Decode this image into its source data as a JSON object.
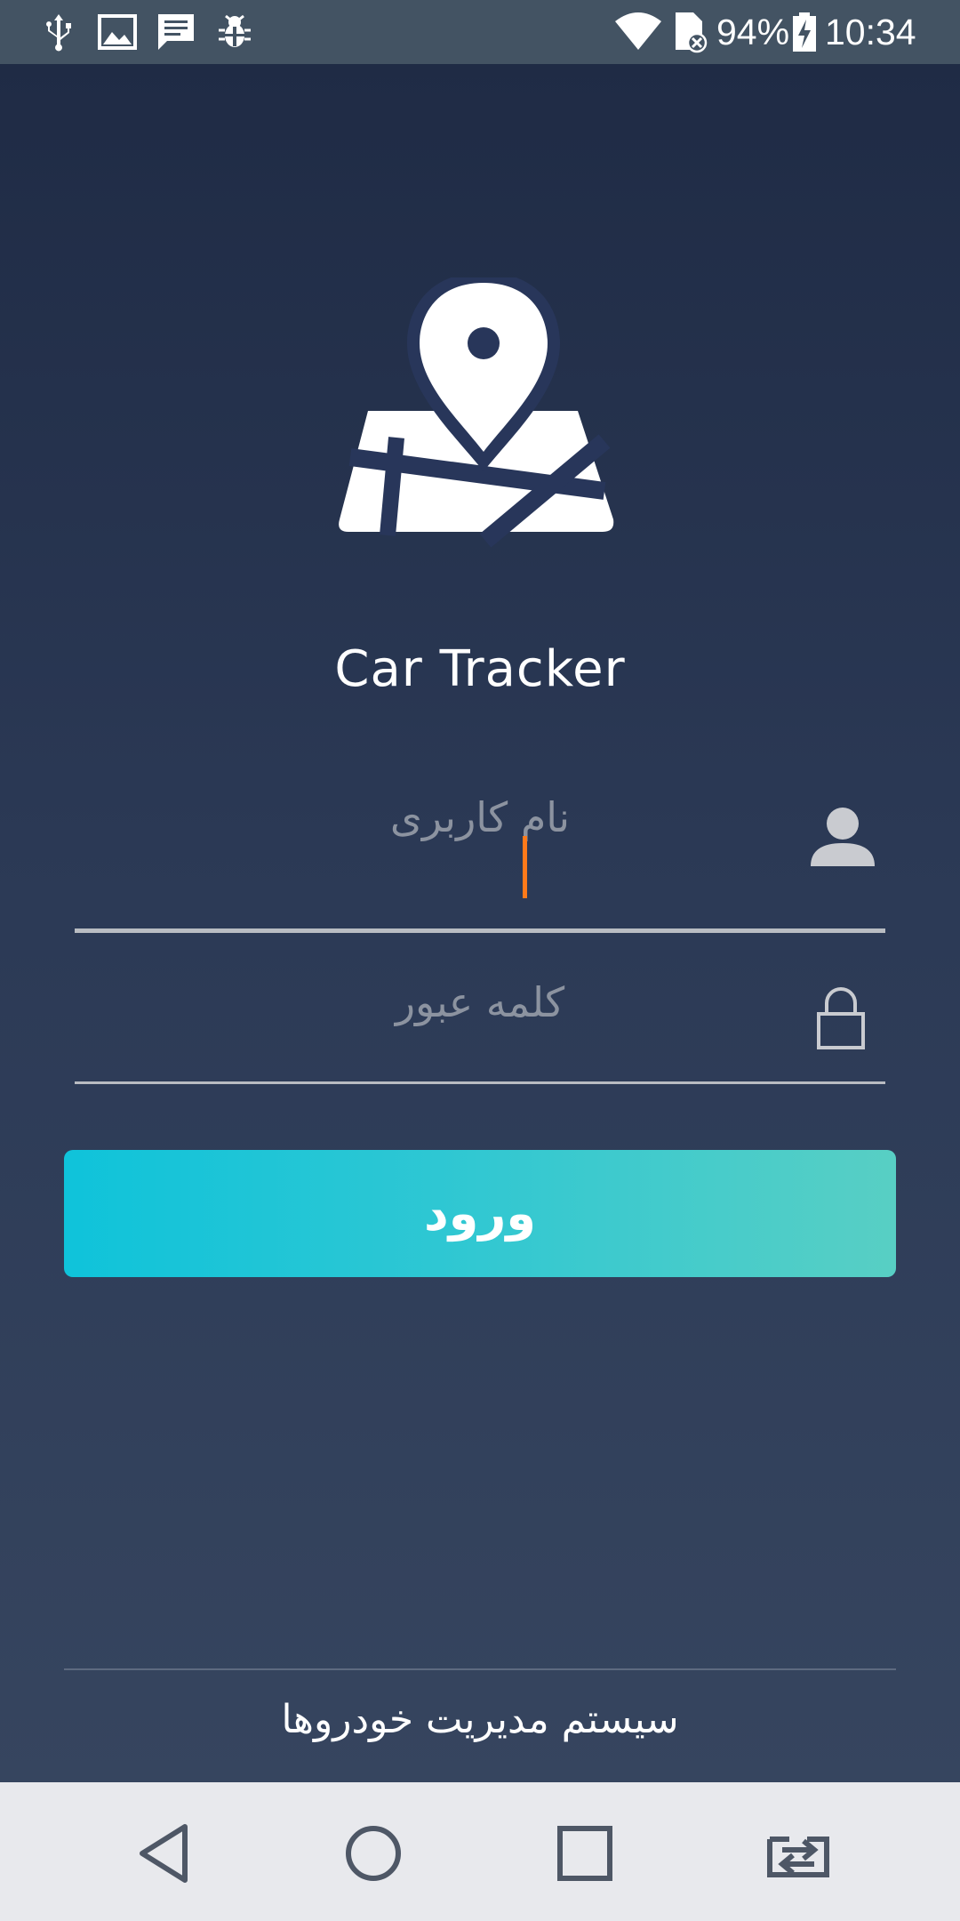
{
  "status_bar": {
    "left_icons": [
      "usb-icon",
      "image-icon",
      "message-icon",
      "bug-icon"
    ],
    "right_icons": [
      "wifi-icon",
      "sim-card-no-signal-icon",
      "battery-charging-icon"
    ],
    "battery": "94%",
    "time": "10:34"
  },
  "app": {
    "logo_icon": "map-pin-icon",
    "title": "Car Tracker"
  },
  "form": {
    "username_placeholder": "نام کاربری",
    "username_value": "",
    "username_icon": "user-icon",
    "password_placeholder": "کلمه عبور",
    "password_value": "",
    "password_icon": "lock-icon",
    "login_label": "ورود"
  },
  "footer": {
    "text": "سیستم مدیریت خودروها"
  },
  "nav_bar": {
    "buttons": [
      "back-icon",
      "home-icon",
      "recents-icon",
      "switch-app-icon"
    ]
  },
  "colors": {
    "background_top": "#1f2b45",
    "background_bottom": "#36455f",
    "accent_start": "#0fc3da",
    "accent_end": "#58cfc4",
    "cursor": "#ff7a1a",
    "status_bar": "#435363",
    "nav_bar": "#e8e9ed"
  }
}
